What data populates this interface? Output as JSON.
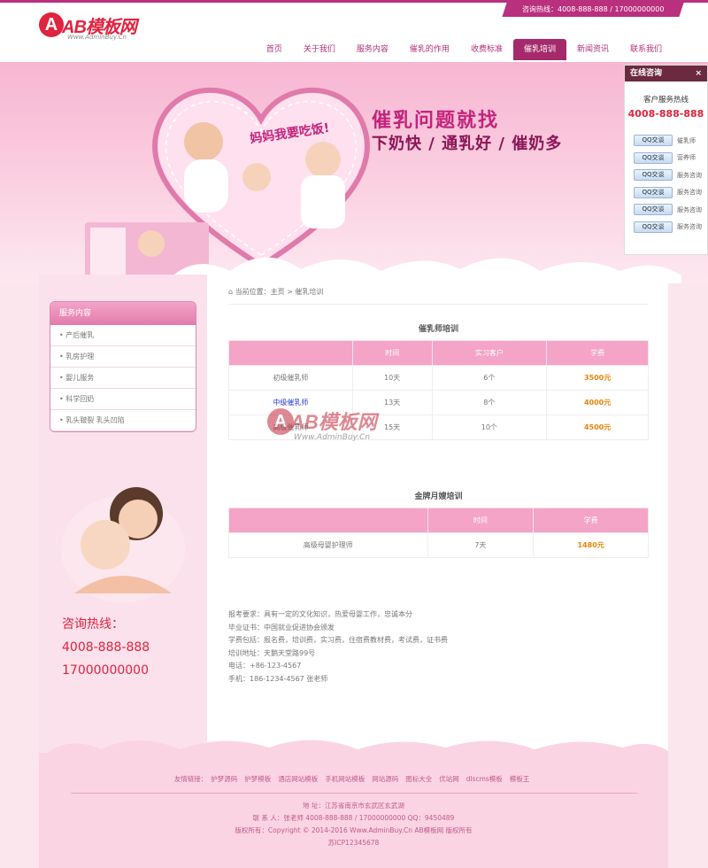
{
  "header": {
    "hotline": "咨询热线：4008-888-888 / 17000000000",
    "logo_text": "AB模板网",
    "logo_letter": "A",
    "logo_url": "Www.AdminBuy.Cn",
    "nav": [
      "首页",
      "关于我们",
      "服务内容",
      "催乳的作用",
      "收费标准",
      "催乳培训",
      "新闻资讯",
      "联系我们"
    ],
    "active_nav": "催乳培训"
  },
  "banner": {
    "bubble": "妈妈我要吃饭!",
    "slogan1": "催乳问题就找",
    "slogan2": "下奶快 / 通乳好 / 催奶多"
  },
  "sidebar": {
    "menu_title": "服务内容",
    "menu_items": [
      "产后催乳",
      "乳房护理",
      "婴儿服务",
      "科学回奶",
      "乳头皲裂 乳头凹陷"
    ],
    "hotline_label": "咨询热线：",
    "hotline_1": "4008-888-888",
    "hotline_2": "17000000000"
  },
  "breadcrumb": "当前位置：主页 > 催乳培训",
  "table1": {
    "title": "催乳师培训",
    "headers": [
      "",
      "时间",
      "实习客户",
      "学费"
    ],
    "rows": [
      [
        "初级催乳师",
        "10天",
        "6个",
        "3500元"
      ],
      [
        "中级催乳师",
        "13天",
        "8个",
        "4000元"
      ],
      [
        "高级催乳师",
        "15天",
        "10个",
        "4500元"
      ]
    ]
  },
  "table2": {
    "title": "金牌月嫂培训",
    "headers": [
      "",
      "时间",
      "学费"
    ],
    "rows": [
      [
        "高级母婴护理师",
        "7天",
        "1480元"
      ]
    ]
  },
  "info_lines": [
    "报考要求：具有一定的文化知识，热爱母婴工作，忠诚本分",
    "毕业证书：中国就业促进协会颁发",
    "学费包括：报名费，培训费，实习费，住宿费教材费，考试费，证书费",
    "培训地址：天鹅天堂路99号",
    "电话：+86-123-4567",
    "手机：186-1234-4567 张老师"
  ],
  "watermark": {
    "letter": "A",
    "text": "AB模板网",
    "url": "Www.AdminBuy.Cn"
  },
  "footer": {
    "friend_label": "友情链接：",
    "friend_links": [
      "护梦源码",
      "护梦模板",
      "酒店网站模板",
      "手机网站模板",
      "网站源码",
      "图标大全",
      "优站网",
      "dlscms模板",
      "模板王"
    ],
    "lines": [
      "地 址：江苏省南京市玄武区玄武湖",
      "联 系 人：张老师 4008-888-888 / 17000000000 QQ：9450489",
      "版权所有：Copyright © 2014-2016 Www.AdminBuy.Cn AB模板网 版权所有",
      "苏ICP12345678"
    ]
  },
  "qq_panel": {
    "title": "在线咨询",
    "close": "×",
    "service_label": "客户服务热线",
    "phone": "4008-888-888",
    "button_label": "QQ交谈",
    "agents": [
      "催乳师",
      "营养师",
      "服务咨询",
      "服务咨询",
      "服务咨询",
      "服务咨询"
    ]
  },
  "colors": {
    "brand": "#b9307f",
    "pink": "#f3a4c7",
    "red": "#e0233e",
    "price": "#e8840a"
  }
}
